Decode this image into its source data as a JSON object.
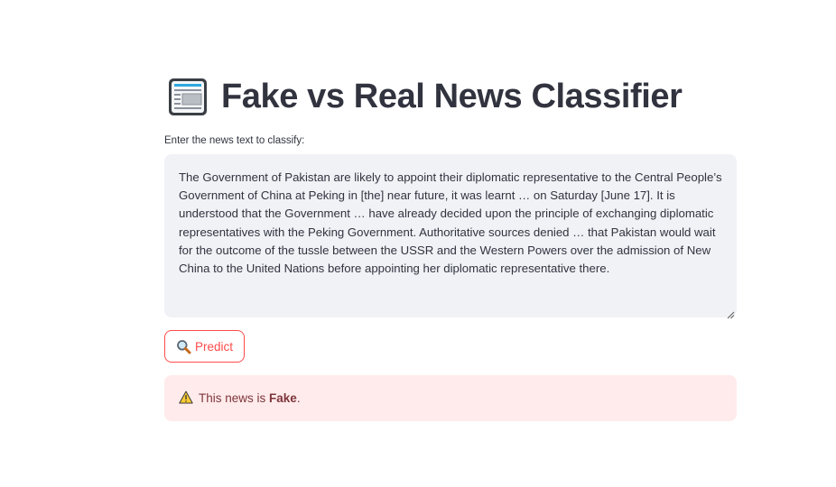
{
  "header": {
    "icon": "newspaper-icon",
    "title": "Fake vs Real News Classifier"
  },
  "input": {
    "label": "Enter the news text to classify:",
    "value": "The Government of Pakistan are likely to appoint their diplomatic representative to the Central People’s Government of China at Peking in [the] near future, it was learnt … on Saturday [June 17]. It is understood that the Government … have already decided upon the principle of exchanging diplomatic representatives with the Peking Government. Authoritative sources denied … that Pakistan would wait for the outcome of the tussle between the USSR and the Western Powers over the admission of New China to the United Nations before appointing her diplomatic representative there."
  },
  "predict_button": {
    "icon": "magnifying-glass-icon",
    "label": "Predict"
  },
  "result": {
    "icon": "warning-icon",
    "prefix": "This news is ",
    "verdict": "Fake",
    "suffix": ".",
    "background": "#ffebeb",
    "text_color": "#7d353b"
  },
  "colors": {
    "accent": "#ff4b4b",
    "input_background": "#f0f2f6",
    "text": "#31333f"
  }
}
